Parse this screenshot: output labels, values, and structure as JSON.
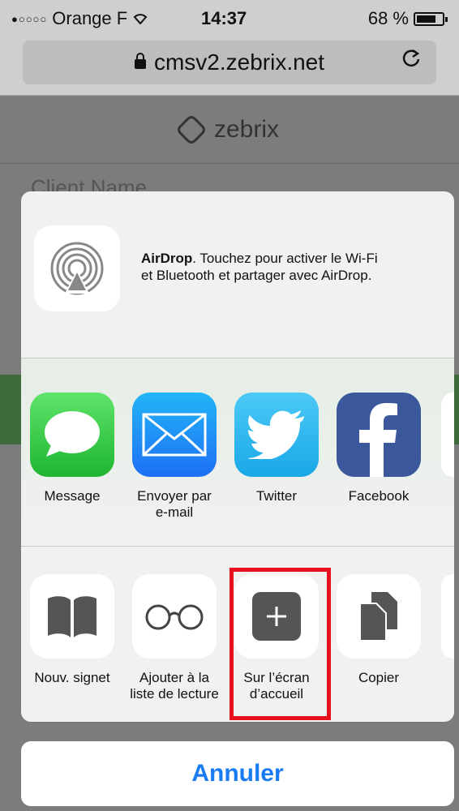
{
  "status_bar": {
    "signal_dots": "●○○○○",
    "carrier": "Orange F",
    "time": "14:37",
    "battery": "68 %"
  },
  "url_bar": {
    "url": "cmsv2.zebrix.net"
  },
  "page": {
    "brand": "zebrix",
    "client_placeholder": "Client Name"
  },
  "share_sheet": {
    "airdrop": {
      "title": "AirDrop",
      "description_line1": ". Touchez pour activer le Wi-Fi",
      "description_line2": "et Bluetooth et partager avec AirDrop."
    },
    "apps": [
      {
        "label": "Message",
        "icon": "message-icon"
      },
      {
        "label1": "Envoyer par",
        "label2": "e-mail",
        "icon": "mail-icon"
      },
      {
        "label": "Twitter",
        "icon": "twitter-icon"
      },
      {
        "label": "Facebook",
        "icon": "facebook-icon"
      }
    ],
    "actions": [
      {
        "label": "Nouv. signet",
        "icon": "book-icon"
      },
      {
        "label1": "Ajouter à la",
        "label2": "liste de lecture",
        "icon": "glasses-icon"
      },
      {
        "label1": "Sur l’écran",
        "label2": "d’accueil",
        "icon": "add-home-icon"
      },
      {
        "label": "Copier",
        "icon": "copy-icon"
      }
    ],
    "highlight_color": "#e8101e"
  },
  "cancel_label": "Annuler"
}
